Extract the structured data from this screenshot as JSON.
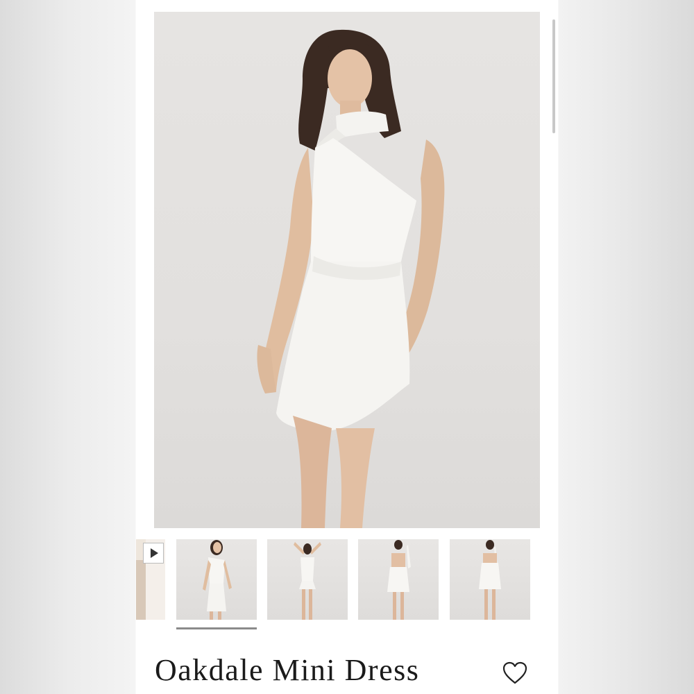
{
  "product": {
    "title": "Oakdale Mini Dress"
  },
  "gallery": {
    "main_image_alt": "Model wearing white one-shoulder mini dress with neck scarf",
    "thumbnails": [
      {
        "kind": "video",
        "icon": "play-icon"
      },
      {
        "kind": "image",
        "view": "front",
        "active": true
      },
      {
        "kind": "image",
        "view": "front-arms-up",
        "active": false
      },
      {
        "kind": "image",
        "view": "back",
        "active": false
      },
      {
        "kind": "image",
        "view": "back-2",
        "active": false
      }
    ]
  },
  "actions": {
    "wishlist_icon": "heart-outline-icon"
  },
  "colors": {
    "background": "#ffffff",
    "text": "#1a1a1a",
    "dress": "#f7f6f3",
    "hair": "#3b2a22",
    "skin": "#e4c2a6",
    "studio_wall": "#e4e2e0"
  }
}
